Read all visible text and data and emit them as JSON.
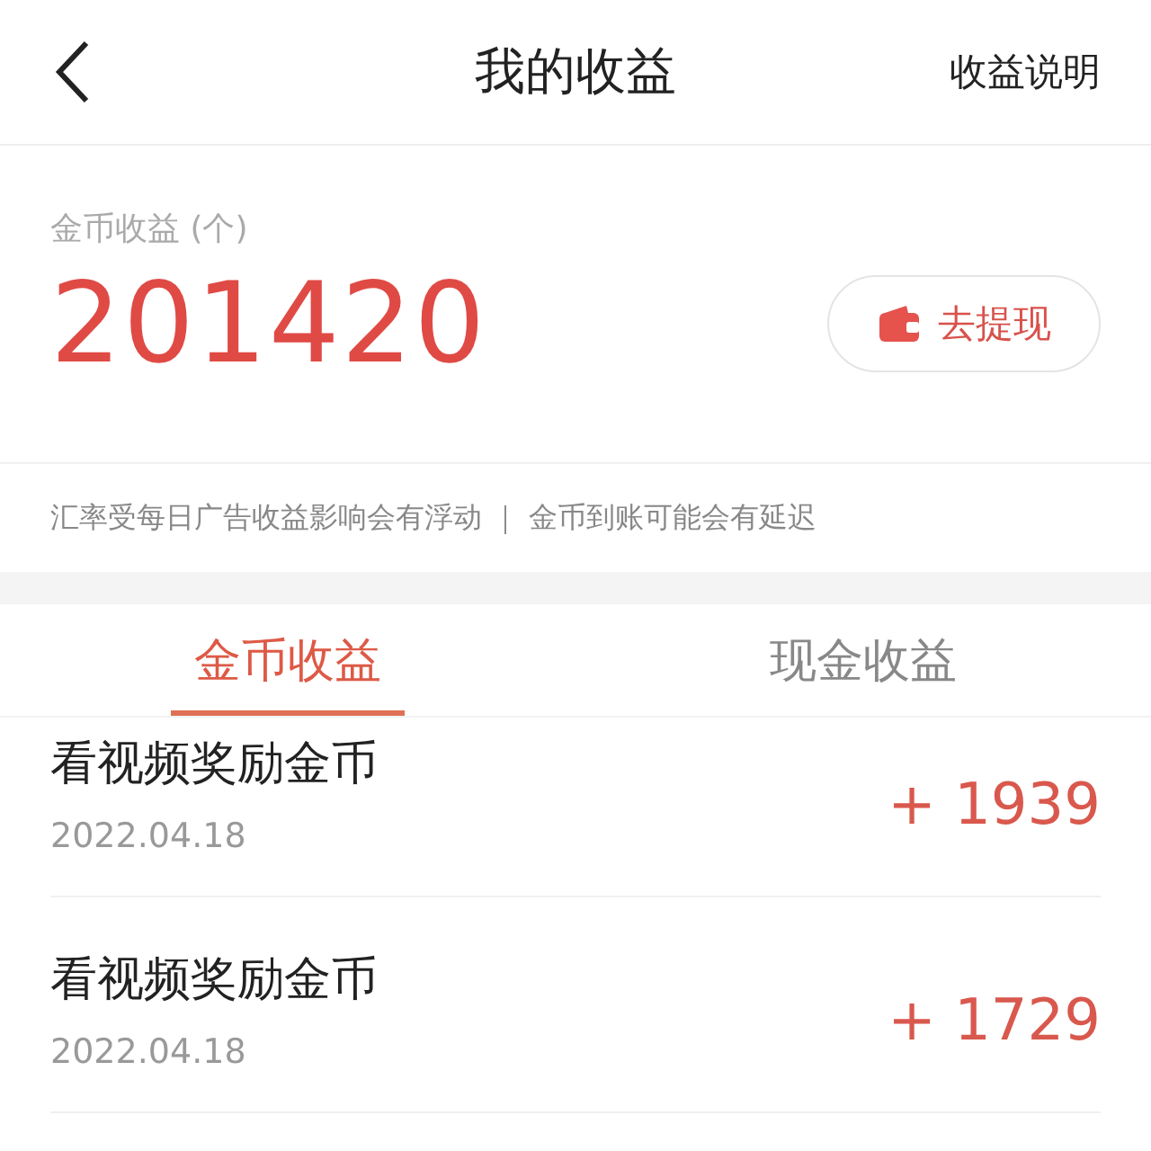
{
  "header": {
    "title": "我的收益",
    "action": "收益说明"
  },
  "balance": {
    "label": "金币收益 (个)",
    "amount": "201420",
    "withdraw_button": "去提现"
  },
  "notice": "汇率受每日广告收益影响会有浮动 ｜ 金币到账可能会有延迟",
  "tabs": [
    {
      "label": "金币收益",
      "selected": true
    },
    {
      "label": "现金收益",
      "selected": false
    }
  ],
  "records": [
    {
      "title": "看视频奖励金币",
      "date": "2022.04.18",
      "amount": "+ 1939"
    },
    {
      "title": "看视频奖励金币",
      "date": "2022.04.18",
      "amount": "+ 1729"
    }
  ]
}
